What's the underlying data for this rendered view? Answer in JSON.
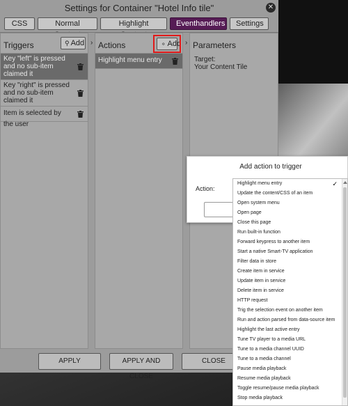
{
  "dialog": {
    "title": "Settings for Container \"Hotel Info tile\"",
    "close_icon": "close-icon",
    "tabs": [
      {
        "label": "CSS",
        "active": false
      },
      {
        "label": "Normal Content",
        "active": false
      },
      {
        "label": "Highlight Content",
        "active": false
      },
      {
        "label": "Eventhandlers",
        "active": true
      },
      {
        "label": "Settings",
        "active": false
      }
    ]
  },
  "triggers": {
    "header": "Triggers",
    "add_label": "Add",
    "items": [
      {
        "label": "Key \"left\" is pressed and no sub-item claimed it",
        "selected": true
      },
      {
        "label": "Key \"right\" is pressed and no sub-item claimed it",
        "selected": false
      },
      {
        "label": "Item is selected by the user",
        "selected": false
      }
    ]
  },
  "actions": {
    "arrow": "›",
    "header": "Actions",
    "add_label": "Add",
    "items": [
      {
        "label": "Highlight menu entry",
        "selected": true
      }
    ]
  },
  "parameters": {
    "arrow": "›",
    "header": "Parameters",
    "target_label": "Target:",
    "target_value": "Your Content Tile"
  },
  "footer": {
    "apply": "APPLY",
    "apply_close": "APPLY AND CLOSE",
    "close": "CLOSE"
  },
  "popup": {
    "title": "Add action to trigger",
    "action_label": "Action:"
  },
  "dropdown": {
    "selected_mark": "✓",
    "options": [
      "Highlight menu entry",
      "Update the content/CSS of an item",
      "Open system menu",
      "Open page",
      "Close this page",
      "Run built-in function",
      "Forward keypress to another item",
      "Start a native Smart-TV application",
      "Filter data in store",
      "Create item in service",
      "Update item in service",
      "Delete item in service",
      "HTTP request",
      "Trig the selection event on another item",
      "Run and action parsed from data-source item",
      "Highlight the last active entry",
      "Tune TV player to a media URL",
      "Tune to a media channel UUID",
      "Tune to a media channel",
      "Pause media playback",
      "Resume media playback",
      "Toggle resume/pause media playback",
      "Stop media playback"
    ],
    "selected_index": 0
  },
  "colors": {
    "active_tab": "#561c55",
    "highlight_box": "#e21a1a",
    "selected_row": "#6a6a6a"
  }
}
